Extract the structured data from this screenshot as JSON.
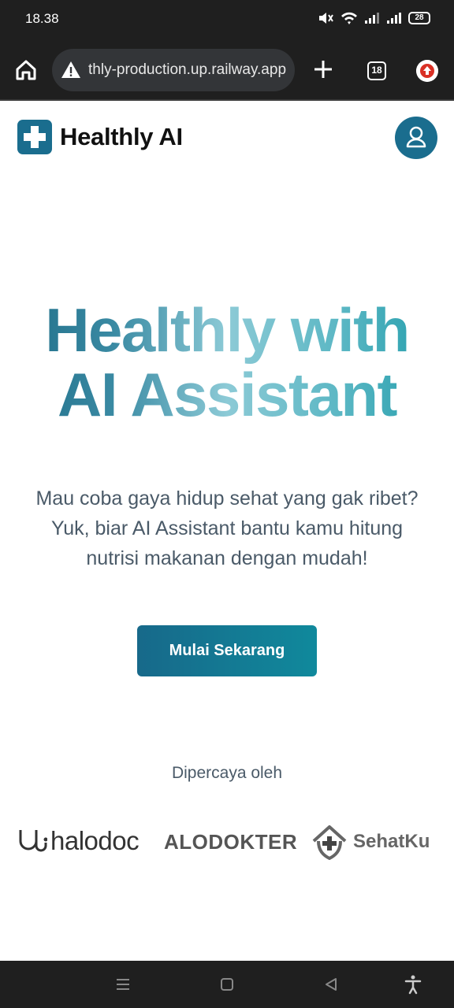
{
  "status_bar": {
    "time": "18.38",
    "battery": "28",
    "icons": [
      "mute-icon",
      "wifi-icon",
      "signal-icon",
      "signal-icon",
      "battery-icon"
    ]
  },
  "browser": {
    "url": "thly-production.up.railway.app",
    "tab_count": "18",
    "icons": [
      "home-icon",
      "warning-icon",
      "plus-icon",
      "tabs-icon",
      "update-icon"
    ]
  },
  "header": {
    "brand": "Healthly AI",
    "logo_icon": "medical-cross-icon",
    "profile_icon": "user-icon",
    "accent_color": "#1a6d8e"
  },
  "hero": {
    "title_line1": "Healthly with",
    "title_line2": "AI Assistant",
    "subtitle": "Mau coba gaya hidup sehat yang gak ribet? Yuk, biar AI Assistant bantu kamu hitung nutrisi makanan dengan mudah!",
    "cta_label": "Mulai Sekarang"
  },
  "trusted": {
    "label": "Dipercaya oleh",
    "partners": [
      {
        "name": "halodoc",
        "icon": "stethoscope-icon"
      },
      {
        "name": "ALODOKTER"
      },
      {
        "name": "SehatKu",
        "icon": "house-cross-icon"
      }
    ]
  },
  "nav_bar": {
    "icons": [
      "menu-icon",
      "home-square-icon",
      "back-icon",
      "accessibility-icon"
    ]
  }
}
